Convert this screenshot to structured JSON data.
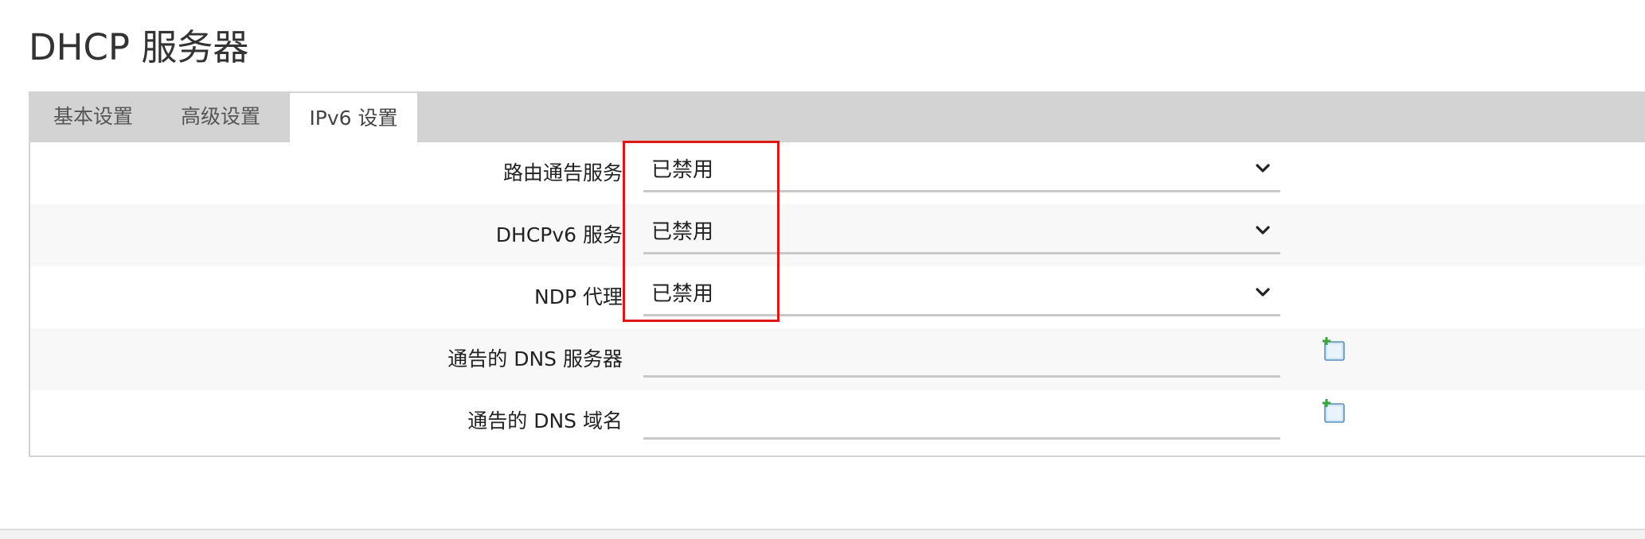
{
  "page": {
    "title": "DHCP 服务器"
  },
  "tabs": [
    {
      "label": "基本设置",
      "active": false
    },
    {
      "label": "高级设置",
      "active": false
    },
    {
      "label": "IPv6 设置",
      "active": true
    }
  ],
  "settings": {
    "router_advertisement": {
      "label": "路由通告服务",
      "value": "已禁用",
      "control": "select"
    },
    "dhcpv6": {
      "label": "DHCPv6 服务",
      "value": "已禁用",
      "control": "select"
    },
    "ndp_proxy": {
      "label": "NDP 代理",
      "value": "已禁用",
      "control": "select"
    },
    "announced_dns_servers": {
      "label": "通告的 DNS 服务器",
      "value": "",
      "control": "dynamic-list",
      "icon": "add-entry-icon"
    },
    "announced_dns_domains": {
      "label": "通告的 DNS 域名",
      "value": "",
      "control": "dynamic-list",
      "icon": "add-entry-icon"
    }
  },
  "colors": {
    "tabbar_bg": "#d3d3d3",
    "highlight_box": "#e01515",
    "row_shade": "#f8f8f8",
    "underline": "#c8c8c8"
  }
}
